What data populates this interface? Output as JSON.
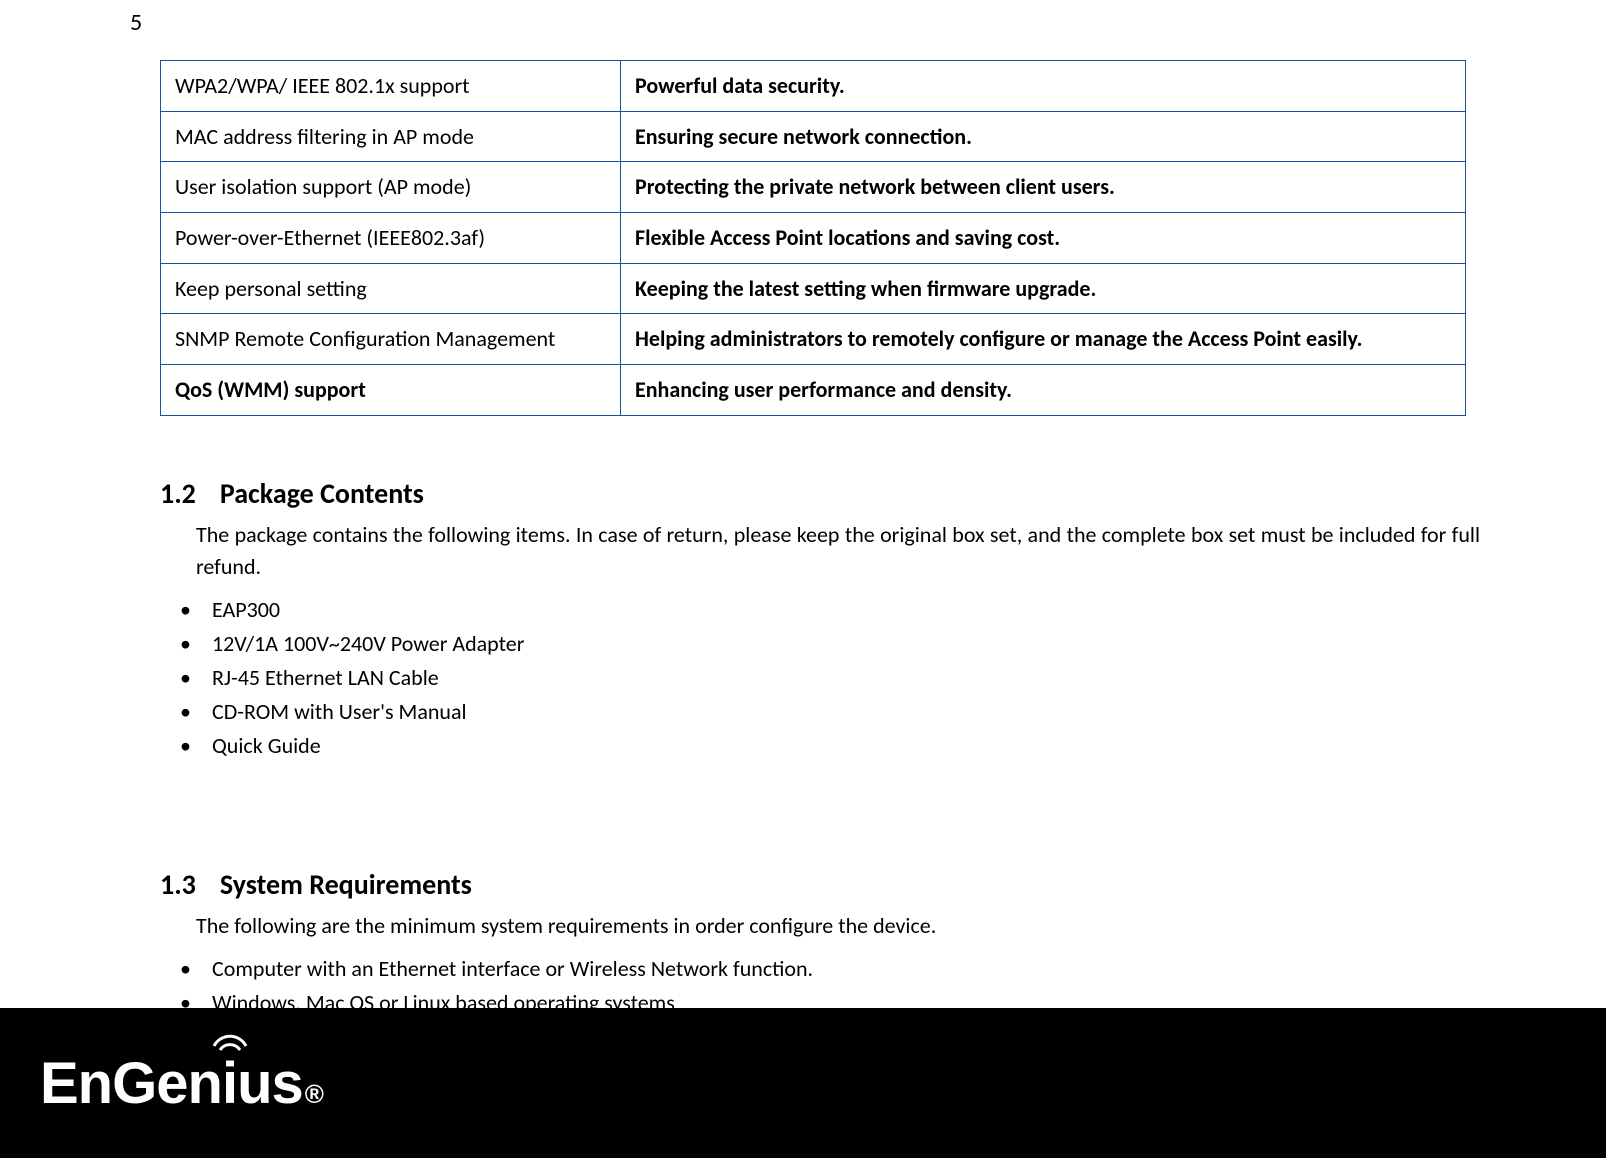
{
  "page_number": "5",
  "feature_table": {
    "rows": [
      {
        "feature": "WPA2/WPA/ IEEE 802.1x support",
        "benefit": "Powerful data security.",
        "bold_feature": false
      },
      {
        "feature": "MAC address filtering in AP mode",
        "benefit": "Ensuring secure network connection.",
        "bold_feature": false
      },
      {
        "feature": "User isolation support (AP mode)",
        "benefit": "Protecting the private network between client users.",
        "bold_feature": false
      },
      {
        "feature": "Power-over-Ethernet (IEEE802.3af)",
        "benefit": "Flexible Access Point locations and saving cost.",
        "bold_feature": false
      },
      {
        "feature": "Keep personal setting",
        "benefit": "Keeping the latest setting when firmware upgrade.",
        "bold_feature": false
      },
      {
        "feature": "SNMP Remote Configuration Management",
        "benefit": "Helping administrators to remotely configure or manage the Access Point easily.",
        "bold_feature": false
      },
      {
        "feature": "QoS (WMM) support",
        "benefit": "Enhancing user performance and density.",
        "bold_feature": true
      }
    ]
  },
  "sections": {
    "package": {
      "number": "1.2",
      "title": "Package Contents",
      "intro": "The package contains the following items. In case of return, please keep the original box set, and the complete box set must be included for full refund.",
      "items": [
        "EAP300",
        "12V/1A 100V~240V Power Adapter",
        "RJ-45 Ethernet LAN Cable",
        "CD-ROM with User's Manual",
        "Quick Guide"
      ]
    },
    "sysreq": {
      "number": "1.3",
      "title": "System Requirements",
      "intro": "The following are the minimum system requirements in order configure the device.",
      "items": [
        "Computer with an Ethernet interface or Wireless Network function.",
        "Windows, Mac OS or Linux based operating systems"
      ]
    }
  },
  "logo": {
    "text_en": "En",
    "text_g": "G",
    "text_en2": "en",
    "text_i": "i",
    "text_us": "us",
    "reg": "®"
  }
}
